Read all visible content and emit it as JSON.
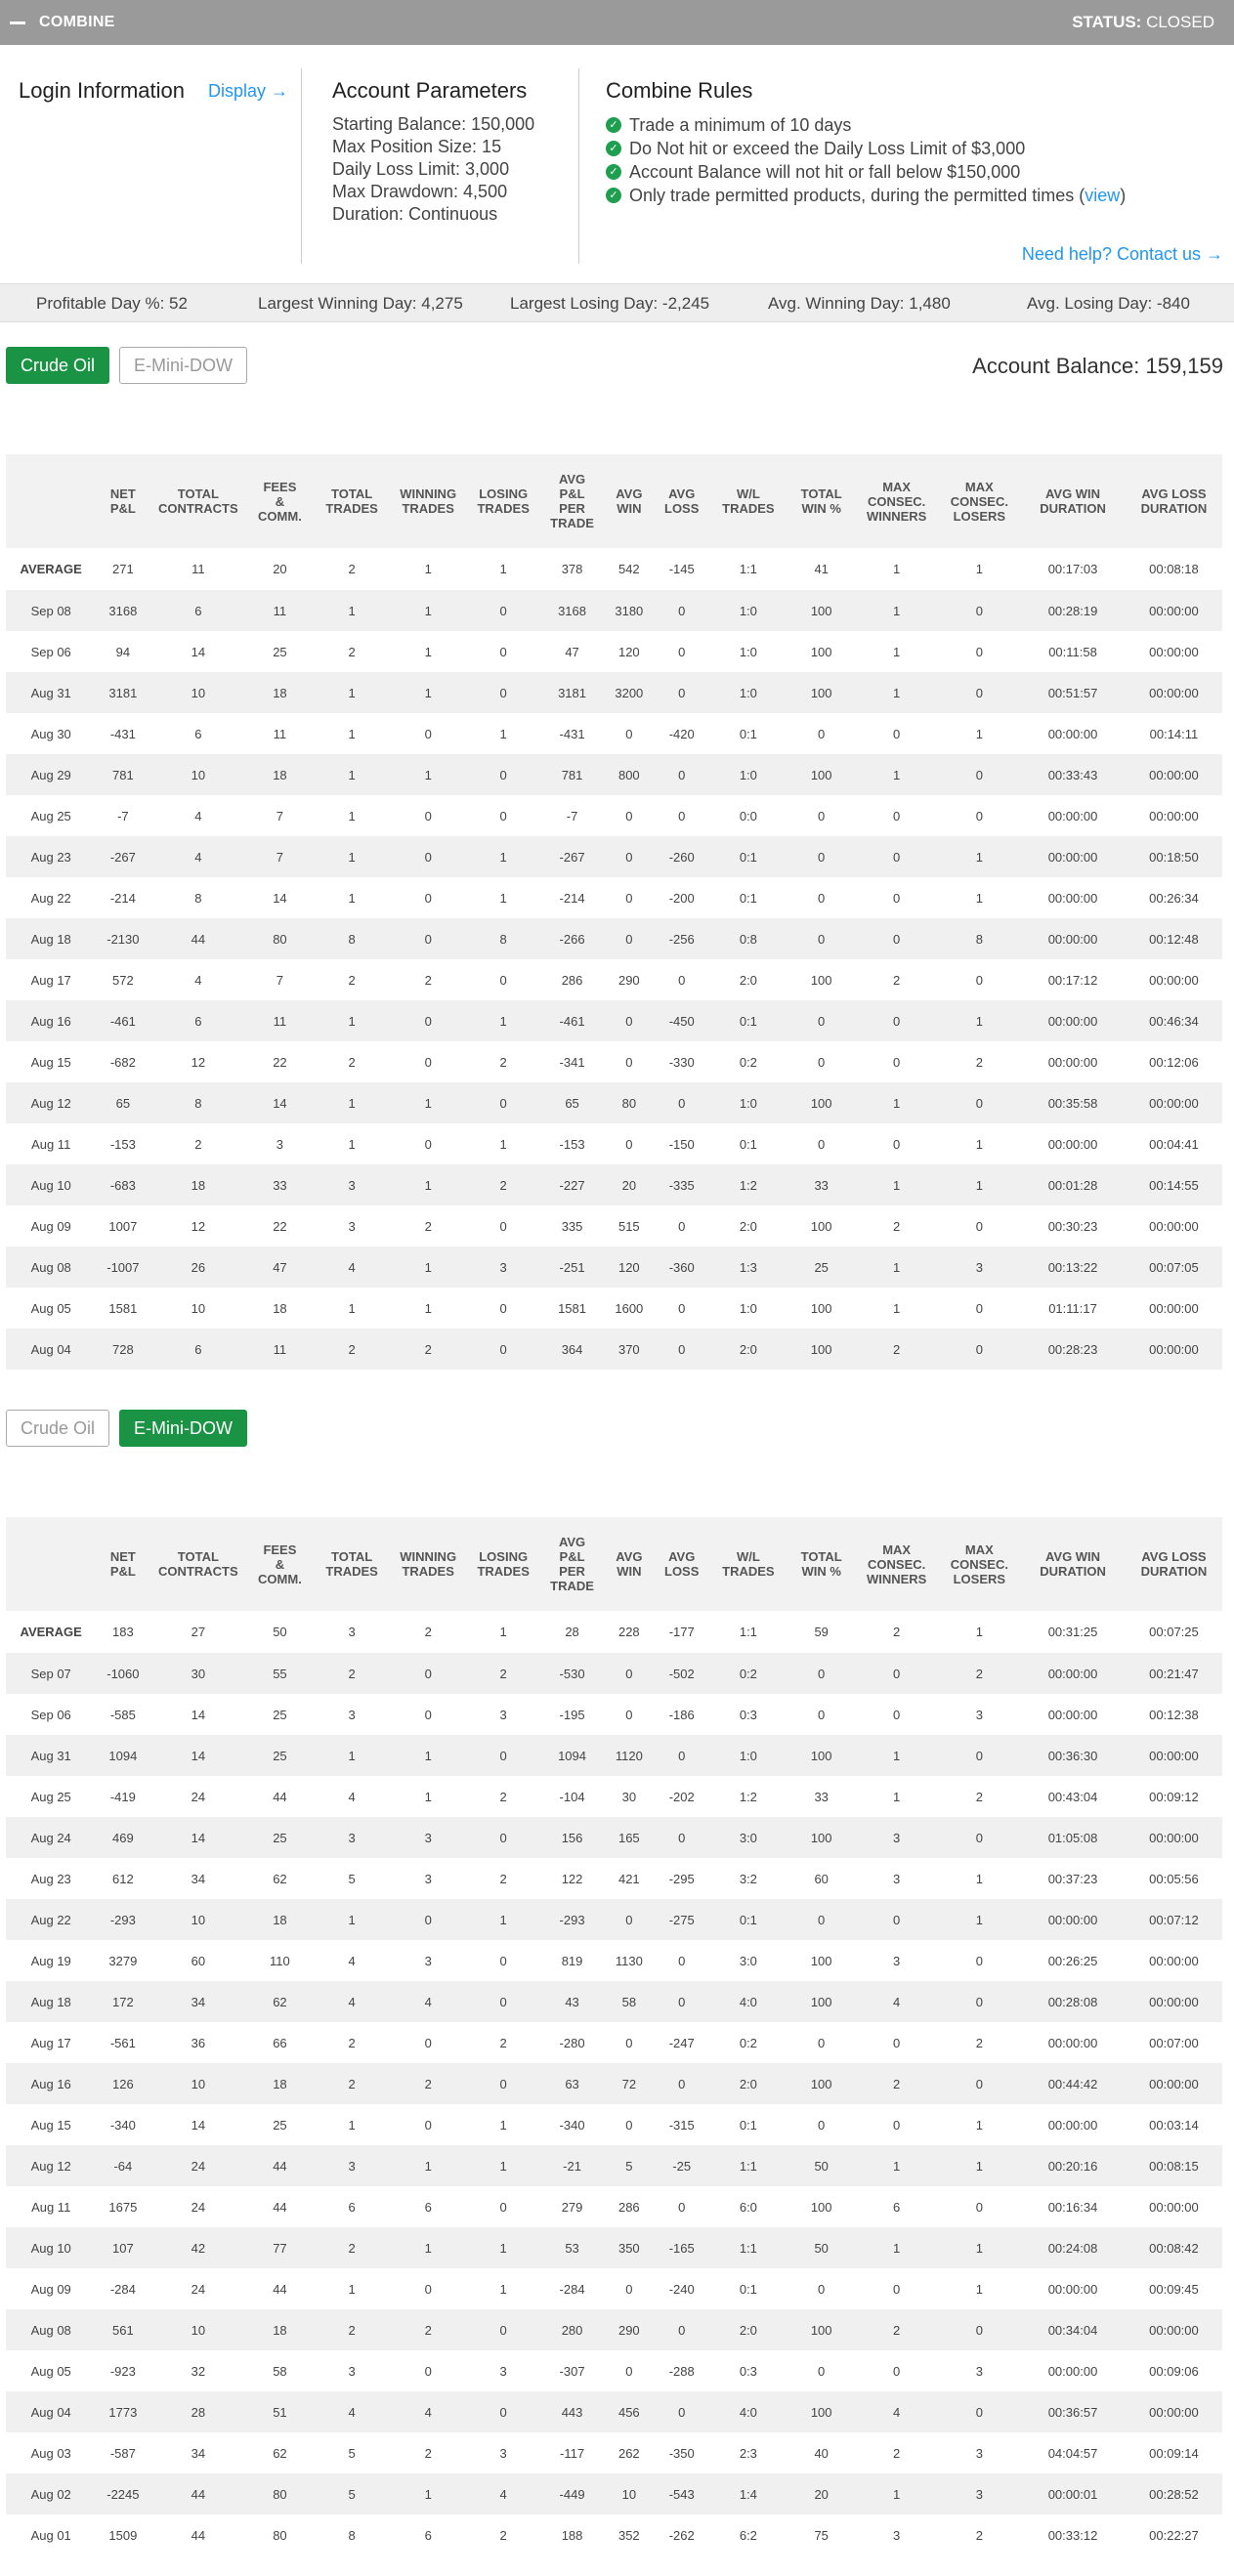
{
  "header": {
    "title": "COMBINE",
    "status_label": "STATUS:",
    "status_value": "CLOSED"
  },
  "login": {
    "title": "Login Information",
    "display_link": "Display →"
  },
  "params": {
    "title": "Account Parameters",
    "lines": [
      "Starting Balance: 150,000",
      "Max Position Size: 15",
      "Daily Loss Limit: 3,000",
      "Max Drawdown: 4,500",
      "Duration: Continuous"
    ]
  },
  "rules": {
    "title": "Combine Rules",
    "items": [
      "Trade a minimum of 10 days",
      "Do Not hit or exceed the Daily Loss Limit of $3,000",
      "Account Balance will not hit or fall below $150,000",
      "Only trade permitted products, during the permitted times ("
    ],
    "view_link": "view",
    "view_suffix": ")",
    "help_link": "Need help? Contact us →"
  },
  "stats": {
    "profitable_day": "Profitable Day %: 52",
    "largest_win": "Largest Winning Day: 4,275",
    "largest_loss": "Largest Losing Day: -2,245",
    "avg_win": "Avg. Winning Day: 1,480",
    "avg_loss": "Avg. Losing Day: -840"
  },
  "tabs": {
    "crude": "Crude Oil",
    "dow": "E-Mini-DOW"
  },
  "account_balance": "Account Balance: 159,159",
  "columns": [
    [
      "",
      ""
    ],
    [
      "NET",
      "P&L"
    ],
    [
      "TOTAL",
      "CONTRACTS"
    ],
    [
      "FEES",
      "&",
      "COMM."
    ],
    [
      "TOTAL",
      "TRADES"
    ],
    [
      "WINNING",
      "TRADES"
    ],
    [
      "LOSING",
      "TRADES"
    ],
    [
      "AVG",
      "P&L",
      "PER",
      "TRADE"
    ],
    [
      "AVG",
      "WIN"
    ],
    [
      "AVG",
      "LOSS"
    ],
    [
      "W/L",
      "TRADES"
    ],
    [
      "TOTAL",
      "WIN %"
    ],
    [
      "MAX",
      "CONSEC.",
      "WINNERS"
    ],
    [
      "MAX",
      "CONSEC.",
      "LOSERS"
    ],
    [
      "AVG WIN",
      "DURATION"
    ],
    [
      "AVG LOSS",
      "DURATION"
    ]
  ],
  "crude_rows": [
    [
      "AVERAGE",
      "271",
      "11",
      "20",
      "2",
      "1",
      "1",
      "378",
      "542",
      "-145",
      "1:1",
      "41",
      "1",
      "1",
      "00:17:03",
      "00:08:18"
    ],
    [
      "Sep 08",
      "3168",
      "6",
      "11",
      "1",
      "1",
      "0",
      "3168",
      "3180",
      "0",
      "1:0",
      "100",
      "1",
      "0",
      "00:28:19",
      "00:00:00"
    ],
    [
      "Sep 06",
      "94",
      "14",
      "25",
      "2",
      "1",
      "0",
      "47",
      "120",
      "0",
      "1:0",
      "100",
      "1",
      "0",
      "00:11:58",
      "00:00:00"
    ],
    [
      "Aug 31",
      "3181",
      "10",
      "18",
      "1",
      "1",
      "0",
      "3181",
      "3200",
      "0",
      "1:0",
      "100",
      "1",
      "0",
      "00:51:57",
      "00:00:00"
    ],
    [
      "Aug 30",
      "-431",
      "6",
      "11",
      "1",
      "0",
      "1",
      "-431",
      "0",
      "-420",
      "0:1",
      "0",
      "0",
      "1",
      "00:00:00",
      "00:14:11"
    ],
    [
      "Aug 29",
      "781",
      "10",
      "18",
      "1",
      "1",
      "0",
      "781",
      "800",
      "0",
      "1:0",
      "100",
      "1",
      "0",
      "00:33:43",
      "00:00:00"
    ],
    [
      "Aug 25",
      "-7",
      "4",
      "7",
      "1",
      "0",
      "0",
      "-7",
      "0",
      "0",
      "0:0",
      "0",
      "0",
      "0",
      "00:00:00",
      "00:00:00"
    ],
    [
      "Aug 23",
      "-267",
      "4",
      "7",
      "1",
      "0",
      "1",
      "-267",
      "0",
      "-260",
      "0:1",
      "0",
      "0",
      "1",
      "00:00:00",
      "00:18:50"
    ],
    [
      "Aug 22",
      "-214",
      "8",
      "14",
      "1",
      "0",
      "1",
      "-214",
      "0",
      "-200",
      "0:1",
      "0",
      "0",
      "1",
      "00:00:00",
      "00:26:34"
    ],
    [
      "Aug 18",
      "-2130",
      "44",
      "80",
      "8",
      "0",
      "8",
      "-266",
      "0",
      "-256",
      "0:8",
      "0",
      "0",
      "8",
      "00:00:00",
      "00:12:48"
    ],
    [
      "Aug 17",
      "572",
      "4",
      "7",
      "2",
      "2",
      "0",
      "286",
      "290",
      "0",
      "2:0",
      "100",
      "2",
      "0",
      "00:17:12",
      "00:00:00"
    ],
    [
      "Aug 16",
      "-461",
      "6",
      "11",
      "1",
      "0",
      "1",
      "-461",
      "0",
      "-450",
      "0:1",
      "0",
      "0",
      "1",
      "00:00:00",
      "00:46:34"
    ],
    [
      "Aug 15",
      "-682",
      "12",
      "22",
      "2",
      "0",
      "2",
      "-341",
      "0",
      "-330",
      "0:2",
      "0",
      "0",
      "2",
      "00:00:00",
      "00:12:06"
    ],
    [
      "Aug 12",
      "65",
      "8",
      "14",
      "1",
      "1",
      "0",
      "65",
      "80",
      "0",
      "1:0",
      "100",
      "1",
      "0",
      "00:35:58",
      "00:00:00"
    ],
    [
      "Aug 11",
      "-153",
      "2",
      "3",
      "1",
      "0",
      "1",
      "-153",
      "0",
      "-150",
      "0:1",
      "0",
      "0",
      "1",
      "00:00:00",
      "00:04:41"
    ],
    [
      "Aug 10",
      "-683",
      "18",
      "33",
      "3",
      "1",
      "2",
      "-227",
      "20",
      "-335",
      "1:2",
      "33",
      "1",
      "1",
      "00:01:28",
      "00:14:55"
    ],
    [
      "Aug 09",
      "1007",
      "12",
      "22",
      "3",
      "2",
      "0",
      "335",
      "515",
      "0",
      "2:0",
      "100",
      "2",
      "0",
      "00:30:23",
      "00:00:00"
    ],
    [
      "Aug 08",
      "-1007",
      "26",
      "47",
      "4",
      "1",
      "3",
      "-251",
      "120",
      "-360",
      "1:3",
      "25",
      "1",
      "3",
      "00:13:22",
      "00:07:05"
    ],
    [
      "Aug 05",
      "1581",
      "10",
      "18",
      "1",
      "1",
      "0",
      "1581",
      "1600",
      "0",
      "1:0",
      "100",
      "1",
      "0",
      "01:11:17",
      "00:00:00"
    ],
    [
      "Aug 04",
      "728",
      "6",
      "11",
      "2",
      "2",
      "0",
      "364",
      "370",
      "0",
      "2:0",
      "100",
      "2",
      "0",
      "00:28:23",
      "00:00:00"
    ]
  ],
  "dow_rows": [
    [
      "AVERAGE",
      "183",
      "27",
      "50",
      "3",
      "2",
      "1",
      "28",
      "228",
      "-177",
      "1:1",
      "59",
      "2",
      "1",
      "00:31:25",
      "00:07:25"
    ],
    [
      "Sep 07",
      "-1060",
      "30",
      "55",
      "2",
      "0",
      "2",
      "-530",
      "0",
      "-502",
      "0:2",
      "0",
      "0",
      "2",
      "00:00:00",
      "00:21:47"
    ],
    [
      "Sep 06",
      "-585",
      "14",
      "25",
      "3",
      "0",
      "3",
      "-195",
      "0",
      "-186",
      "0:3",
      "0",
      "0",
      "3",
      "00:00:00",
      "00:12:38"
    ],
    [
      "Aug 31",
      "1094",
      "14",
      "25",
      "1",
      "1",
      "0",
      "1094",
      "1120",
      "0",
      "1:0",
      "100",
      "1",
      "0",
      "00:36:30",
      "00:00:00"
    ],
    [
      "Aug 25",
      "-419",
      "24",
      "44",
      "4",
      "1",
      "2",
      "-104",
      "30",
      "-202",
      "1:2",
      "33",
      "1",
      "2",
      "00:43:04",
      "00:09:12"
    ],
    [
      "Aug 24",
      "469",
      "14",
      "25",
      "3",
      "3",
      "0",
      "156",
      "165",
      "0",
      "3:0",
      "100",
      "3",
      "0",
      "01:05:08",
      "00:00:00"
    ],
    [
      "Aug 23",
      "612",
      "34",
      "62",
      "5",
      "3",
      "2",
      "122",
      "421",
      "-295",
      "3:2",
      "60",
      "3",
      "1",
      "00:37:23",
      "00:05:56"
    ],
    [
      "Aug 22",
      "-293",
      "10",
      "18",
      "1",
      "0",
      "1",
      "-293",
      "0",
      "-275",
      "0:1",
      "0",
      "0",
      "1",
      "00:00:00",
      "00:07:12"
    ],
    [
      "Aug 19",
      "3279",
      "60",
      "110",
      "4",
      "3",
      "0",
      "819",
      "1130",
      "0",
      "3:0",
      "100",
      "3",
      "0",
      "00:26:25",
      "00:00:00"
    ],
    [
      "Aug 18",
      "172",
      "34",
      "62",
      "4",
      "4",
      "0",
      "43",
      "58",
      "0",
      "4:0",
      "100",
      "4",
      "0",
      "00:28:08",
      "00:00:00"
    ],
    [
      "Aug 17",
      "-561",
      "36",
      "66",
      "2",
      "0",
      "2",
      "-280",
      "0",
      "-247",
      "0:2",
      "0",
      "0",
      "2",
      "00:00:00",
      "00:07:00"
    ],
    [
      "Aug 16",
      "126",
      "10",
      "18",
      "2",
      "2",
      "0",
      "63",
      "72",
      "0",
      "2:0",
      "100",
      "2",
      "0",
      "00:44:42",
      "00:00:00"
    ],
    [
      "Aug 15",
      "-340",
      "14",
      "25",
      "1",
      "0",
      "1",
      "-340",
      "0",
      "-315",
      "0:1",
      "0",
      "0",
      "1",
      "00:00:00",
      "00:03:14"
    ],
    [
      "Aug 12",
      "-64",
      "24",
      "44",
      "3",
      "1",
      "1",
      "-21",
      "5",
      "-25",
      "1:1",
      "50",
      "1",
      "1",
      "00:20:16",
      "00:08:15"
    ],
    [
      "Aug 11",
      "1675",
      "24",
      "44",
      "6",
      "6",
      "0",
      "279",
      "286",
      "0",
      "6:0",
      "100",
      "6",
      "0",
      "00:16:34",
      "00:00:00"
    ],
    [
      "Aug 10",
      "107",
      "42",
      "77",
      "2",
      "1",
      "1",
      "53",
      "350",
      "-165",
      "1:1",
      "50",
      "1",
      "1",
      "00:24:08",
      "00:08:42"
    ],
    [
      "Aug 09",
      "-284",
      "24",
      "44",
      "1",
      "0",
      "1",
      "-284",
      "0",
      "-240",
      "0:1",
      "0",
      "0",
      "1",
      "00:00:00",
      "00:09:45"
    ],
    [
      "Aug 08",
      "561",
      "10",
      "18",
      "2",
      "2",
      "0",
      "280",
      "290",
      "0",
      "2:0",
      "100",
      "2",
      "0",
      "00:34:04",
      "00:00:00"
    ],
    [
      "Aug 05",
      "-923",
      "32",
      "58",
      "3",
      "0",
      "3",
      "-307",
      "0",
      "-288",
      "0:3",
      "0",
      "0",
      "3",
      "00:00:00",
      "00:09:06"
    ],
    [
      "Aug 04",
      "1773",
      "28",
      "51",
      "4",
      "4",
      "0",
      "443",
      "456",
      "0",
      "4:0",
      "100",
      "4",
      "0",
      "00:36:57",
      "00:00:00"
    ],
    [
      "Aug 03",
      "-587",
      "34",
      "62",
      "5",
      "2",
      "3",
      "-117",
      "262",
      "-350",
      "2:3",
      "40",
      "2",
      "3",
      "04:04:57",
      "00:09:14"
    ],
    [
      "Aug 02",
      "-2245",
      "44",
      "80",
      "5",
      "1",
      "4",
      "-449",
      "10",
      "-543",
      "1:4",
      "20",
      "1",
      "3",
      "00:00:01",
      "00:28:52"
    ],
    [
      "Aug 01",
      "1509",
      "44",
      "80",
      "8",
      "6",
      "2",
      "188",
      "352",
      "-262",
      "6:2",
      "75",
      "3",
      "2",
      "00:33:12",
      "00:22:27"
    ]
  ]
}
